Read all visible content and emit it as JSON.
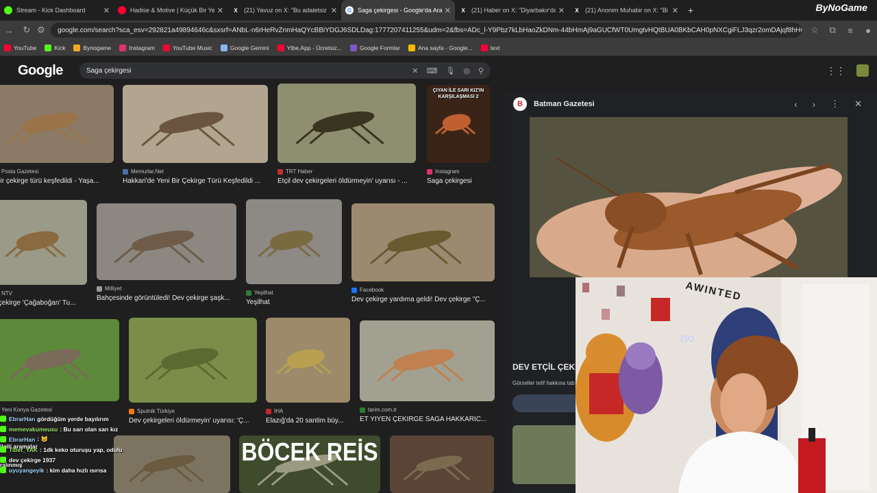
{
  "tabs": [
    {
      "title": "Stream - Kick Dashboard",
      "icon": "kick-icon",
      "color": "#53fc18"
    },
    {
      "title": "Hadise & Motive | Küçük Bir Ye",
      "icon": "youtube-icon",
      "color": "#ff0033"
    },
    {
      "title": "(21) Yavuz on X: \"Bu adaletsiz d",
      "icon": "x-icon",
      "color": "#000000"
    },
    {
      "title": "Saga çekirgesi - Google'da Ara",
      "icon": "google-icon",
      "color": "#ffffff"
    },
    {
      "title": "(21) Haber on X: \"Diyarbakır'da",
      "icon": "x-icon",
      "color": "#000000"
    },
    {
      "title": "(21) Anonim Muhabir on X: \"Bi",
      "icon": "x-icon",
      "color": "#000000"
    }
  ],
  "brand": "ByNoGame",
  "url": "google.com/search?sca_esv=292821a49894646c&sxsrf=ANbL-n6rHeRvZnmHaQYcBBiYDGJ6SDLDag:1777207411255&udm=2&fbs=ADc_l-Y9Pbz7kLbHaoZkDNm-44bHmAj9aGUCfWT0UmgtvHQtBUA0BKbCAH0pNXCgiFLJ3qzr2omDAjqf8hHGrzJ_dmd...",
  "bookmarks": [
    {
      "label": "YouTube",
      "color": "#ff0033"
    },
    {
      "label": "Kick",
      "color": "#53fc18"
    },
    {
      "label": "Bynogame",
      "color": "#f5a623"
    },
    {
      "label": "Instagram",
      "color": "#e1306c"
    },
    {
      "label": "YouTube Music",
      "color": "#ff0033"
    },
    {
      "label": "Google Gemini",
      "color": "#8ab4f8"
    },
    {
      "label": "Ytbe.App - Ücretsiz...",
      "color": "#ff0033"
    },
    {
      "label": "Google Formlar",
      "color": "#7e57c2"
    },
    {
      "label": "Ana sayfa - Google...",
      "color": "#fbbc04"
    },
    {
      "label": "text",
      "color": "#ff0033"
    }
  ],
  "search": {
    "logo": "Google",
    "query": "Saga çekirgesi"
  },
  "results": [
    {
      "source": "Posta Gazetesi",
      "caption": "i bir çekirge türü keşfedildi - Yaşa...",
      "bg": "#8a7a66",
      "bug": "#9a7448",
      "sc": "#555"
    },
    {
      "source": "Memurlar.Net",
      "caption": "Hakkari'de Yeni Bir Çekirge Türü Keşfedildi ...",
      "bg": "#b2a590",
      "bug": "#6b5540",
      "sc": "#4a6fa5"
    },
    {
      "source": "TRT Haber",
      "caption": "Etçil dev çekirgeleri öldürmeyin' uyarısı - ...",
      "bg": "#8e8f70",
      "bug": "#3a3520",
      "sc": "#c4302b"
    },
    {
      "source": "Instagram",
      "caption": "Saga çekirgesi",
      "bg": "#3a2418",
      "bug": "#c06030",
      "sc": "#e1306c"
    },
    {
      "source": "NTV",
      "caption": "v çekirge 'Çağaboğan' Tu...",
      "bg": "#9a9a88",
      "bug": "#8a6a40",
      "sc": "#555"
    },
    {
      "source": "Milliyet",
      "caption": "Bahçesinde görüntüledi! Dev çekirge şaşk...",
      "bg": "#8c8780",
      "bug": "#6e5c48",
      "sc": "#999"
    },
    {
      "source": "Yeşilhat",
      "caption": "Yeşilhat",
      "bg": "#8d8a86",
      "bug": "#7a6a40",
      "sc": "#2e7d32"
    },
    {
      "source": "Facebook",
      "caption": "Dev çekirge yardıma geldi! Dev çekirge \"Ç...",
      "bg": "#9c8a70",
      "bug": "#6a5a30",
      "sc": "#1877f2"
    },
    {
      "source": "Yeni Konya Gazetesi",
      "caption": "",
      "bg": "#5d8a3a",
      "bug": "#7a6a58",
      "sc": "#555"
    },
    {
      "source": "Sputnik Türkiye",
      "caption": "Dev çekirgeleri öldürmeyin' uyarısı: 'Ç...",
      "bg": "#7a8e4a",
      "bug": "#5a6a30",
      "sc": "#ff7a00"
    },
    {
      "source": "IHA",
      "caption": "Elazığ'da 20 santim büy...",
      "bg": "#9c8a6a",
      "bug": "#b8a050",
      "sc": "#c62828"
    },
    {
      "source": "tarim.com.tr",
      "caption": "ET YİYEN ÇEKİRGE SAGA HAKKARİC...",
      "bg": "#a2a090",
      "bug": "#c08050",
      "sc": "#2e7d32"
    },
    {
      "source": "",
      "caption": "",
      "bg": "#7c7460",
      "bug": "#6a5a40",
      "sc": "#555"
    },
    {
      "source": "",
      "caption": "BÖCEK REİS",
      "bg": "#3e4b2c",
      "bug": "#9a9a80",
      "sc": "#555"
    },
    {
      "source": "",
      "caption": "",
      "bg": "#5a4436",
      "bug": "#7a6a50",
      "sc": "#555"
    }
  ],
  "insta_overlay": "ÇIYAN İLE SARI KIZ'IN KARŞILAŞMASI 2",
  "panel": {
    "source": "Batman Gazetesi",
    "title": "DEV ETÇİL ÇEKİ",
    "copyright": "Görseller telif hakkına tab"
  },
  "chat": [
    {
      "user": "EbrarHan",
      "msg": "gördüğüm yerde bayılırım",
      "g": false
    },
    {
      "user": "memevakumeusu",
      "msg": ": Bu sarı olan sarı kız",
      "g": true
    },
    {
      "user": "EbrarHan",
      "msg": ": 😺",
      "g": false
    },
    {
      "user": "Tibet_YAK",
      "msg": ": 1dk keko oturuşu yap, odulu",
      "g": true
    },
    {
      "user": "",
      "msg": "dev çekirge 1937",
      "g": false
    },
    {
      "user": "uyuyangeyik",
      "msg": ": kim daha hızlı ısırısa",
      "g": false
    }
  ],
  "overlay_left": [
    "ilgili aramalar",
    "ralınmış"
  ],
  "webcam_banner": "AWINTED",
  "chair_brand": "ZIO"
}
